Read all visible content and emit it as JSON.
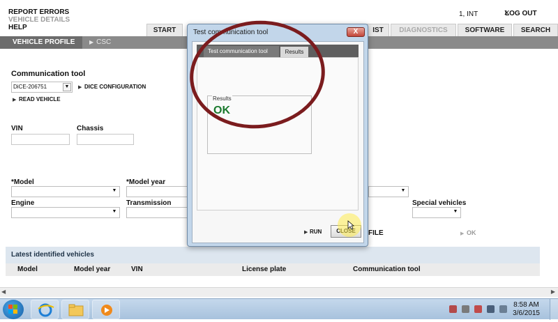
{
  "menu": {
    "report_errors": "REPORT ERRORS",
    "vehicle_details": "VEHICLE DETAILS",
    "help": "HELP"
  },
  "user": {
    "info": "1, INT",
    "logout": "LOG OUT"
  },
  "tabs": [
    {
      "label": "START"
    },
    {
      "label": "IST"
    },
    {
      "label": "DIAGNOSTICS"
    },
    {
      "label": "SOFTWARE"
    },
    {
      "label": "SEARCH"
    }
  ],
  "subnav": {
    "vehicle_profile": "VEHICLE PROFILE",
    "csc": "CSC"
  },
  "comm": {
    "title": "Communication tool",
    "device_selected": "DiCE-206751",
    "dice_config": "DICE CONFIGURATION",
    "read_vehicle": "READ VEHICLE"
  },
  "form": {
    "vin": "VIN",
    "chassis": "Chassis",
    "model": "*Model",
    "model_year": "*Model year",
    "engine": "Engine",
    "transmission": "Transmission",
    "special_vehicles": "Special vehicles",
    "file_label": "FILE",
    "ok_label": "OK"
  },
  "latest": {
    "title": "Latest identified vehicles",
    "columns": [
      "Model",
      "Model year",
      "VIN",
      "License plate",
      "Communication tool"
    ]
  },
  "dialog": {
    "title": "Test communication tool",
    "tab_main": "Test communication tool",
    "tab_results": "Results",
    "results_legend": "Results",
    "result_value": "OK",
    "run": "RUN",
    "close": "CLOSE",
    "close_x": "X"
  },
  "taskbar": {
    "time": "8:58 AM",
    "date": "3/6/2015"
  },
  "colors": {
    "ok_green": "#1b7a2e",
    "annotation": "#7b1c1e",
    "subnav_active": "#6c6c6c"
  },
  "icons": [
    "windows-start-icon",
    "internet-explorer-icon",
    "file-explorer-icon",
    "media-player-icon"
  ]
}
